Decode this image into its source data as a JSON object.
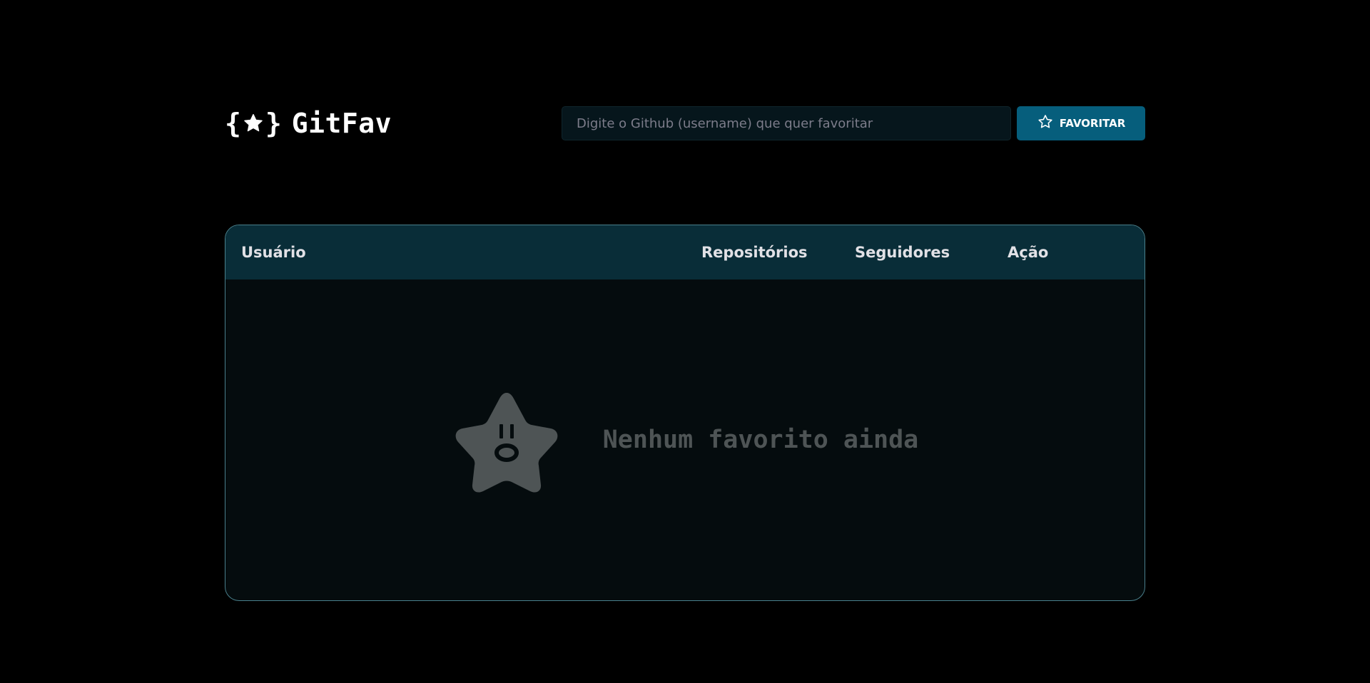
{
  "header": {
    "logo_text": "GitFav",
    "logo_icon": "braces-star-icon"
  },
  "search": {
    "placeholder": "Digite o Github (username) que quer favoritar",
    "value": "",
    "button_label": "FAVORITAR",
    "button_icon": "star-outline-icon"
  },
  "table": {
    "columns": [
      "Usuário",
      "Repositórios",
      "Seguidores",
      "Ação"
    ],
    "rows": []
  },
  "empty_state": {
    "message": "Nenhum favorito ainda",
    "icon": "surprised-star-icon"
  },
  "colors": {
    "background": "#000000",
    "accent": "#065e7c",
    "table_header": "#092d38",
    "table_body": "#050c0e",
    "table_border": "#4a808c",
    "muted": "#4e5455"
  }
}
